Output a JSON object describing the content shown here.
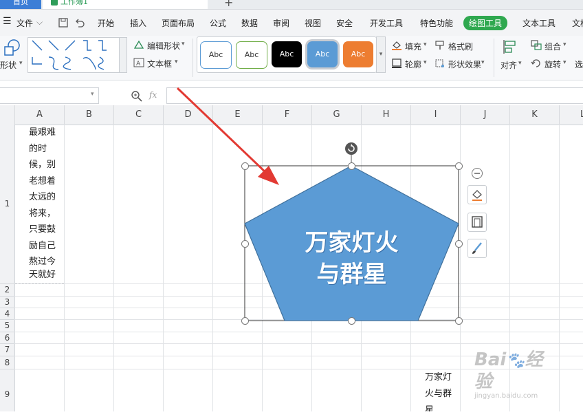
{
  "titlebar": {
    "home_tab": "首页",
    "book_tab": "工作簿1"
  },
  "menu": {
    "items": [
      "文件",
      "开始",
      "插入",
      "页面布局",
      "公式",
      "数据",
      "审阅",
      "视图",
      "安全",
      "开发工具",
      "特色功能",
      "绘图工具",
      "文本工具",
      "文档"
    ],
    "active": "绘图工具"
  },
  "ribbon": {
    "shape_label": "形状",
    "edit_shape": "编辑形状",
    "text_box": "文本框",
    "style_labels": [
      "Abc",
      "Abc",
      "Abc",
      "Abc",
      "Abc"
    ],
    "fill": "填充",
    "format_painter": "格式刷",
    "outline": "轮廓",
    "shape_effects": "形状效果",
    "group": "组合",
    "align": "对齐",
    "rotate": "旋转",
    "select": "选"
  },
  "formula_bar": {
    "fx": "fx"
  },
  "columns": [
    "A",
    "B",
    "C",
    "D",
    "E",
    "F",
    "G",
    "H",
    "I",
    "J",
    "K",
    "L"
  ],
  "rows": [
    "1",
    "2",
    "3",
    "4",
    "5",
    "6",
    "7",
    "8",
    "9"
  ],
  "cells": {
    "a1_lines": [
      "最艰难",
      "的时",
      "候，别",
      "老想着",
      "太远的",
      "将来，",
      "只要鼓",
      "励自己",
      "熬过今",
      "天就好"
    ],
    "i9_lines": [
      "万家灯",
      "火与群",
      "星"
    ]
  },
  "shape": {
    "text_line1": "万家灯火",
    "text_line2": "与群星"
  },
  "colors": {
    "accent_green": "#2fa84f",
    "shape_fill": "#5b9bd5",
    "arrow_red": "#e23a33"
  },
  "icons": [
    "spreadsheet-icon",
    "save-icon",
    "undo-icon",
    "shape-icon",
    "zoom-icon",
    "rotate-handle-icon",
    "collapse-icon",
    "fill-bucket-icon",
    "frame-icon",
    "brush-icon"
  ]
}
